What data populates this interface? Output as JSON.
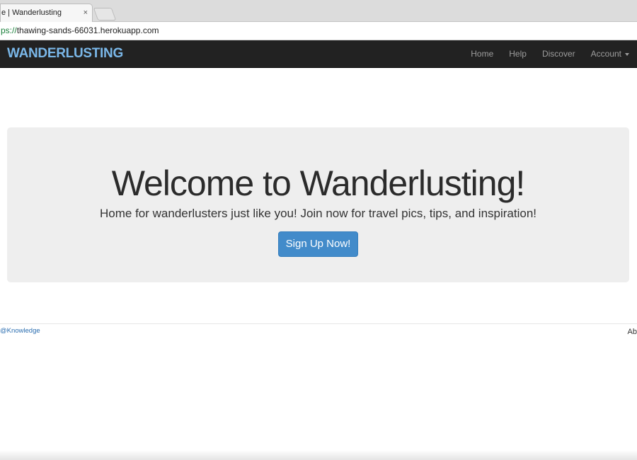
{
  "browser": {
    "tab_title": "e | Wanderlusting",
    "tab_close": "×",
    "address_scheme": "ps://",
    "address_rest": "thawing-sands-66031.herokuapp.com"
  },
  "navbar": {
    "brand": "WANDERLUSTING",
    "links": [
      "Home",
      "Help",
      "Discover",
      "Account"
    ],
    "brand_color": "#7ab7e8",
    "background": "#222222"
  },
  "jumbotron": {
    "title": "Welcome to Wanderlusting!",
    "subtitle": "Home for wanderlusters just like you! Join now for travel pics, tips, and inspiration!",
    "button_label": "Sign Up Now!",
    "button_color": "#428bca"
  },
  "footer": {
    "left_text": "@Knowledge",
    "right_text": "Ab"
  }
}
